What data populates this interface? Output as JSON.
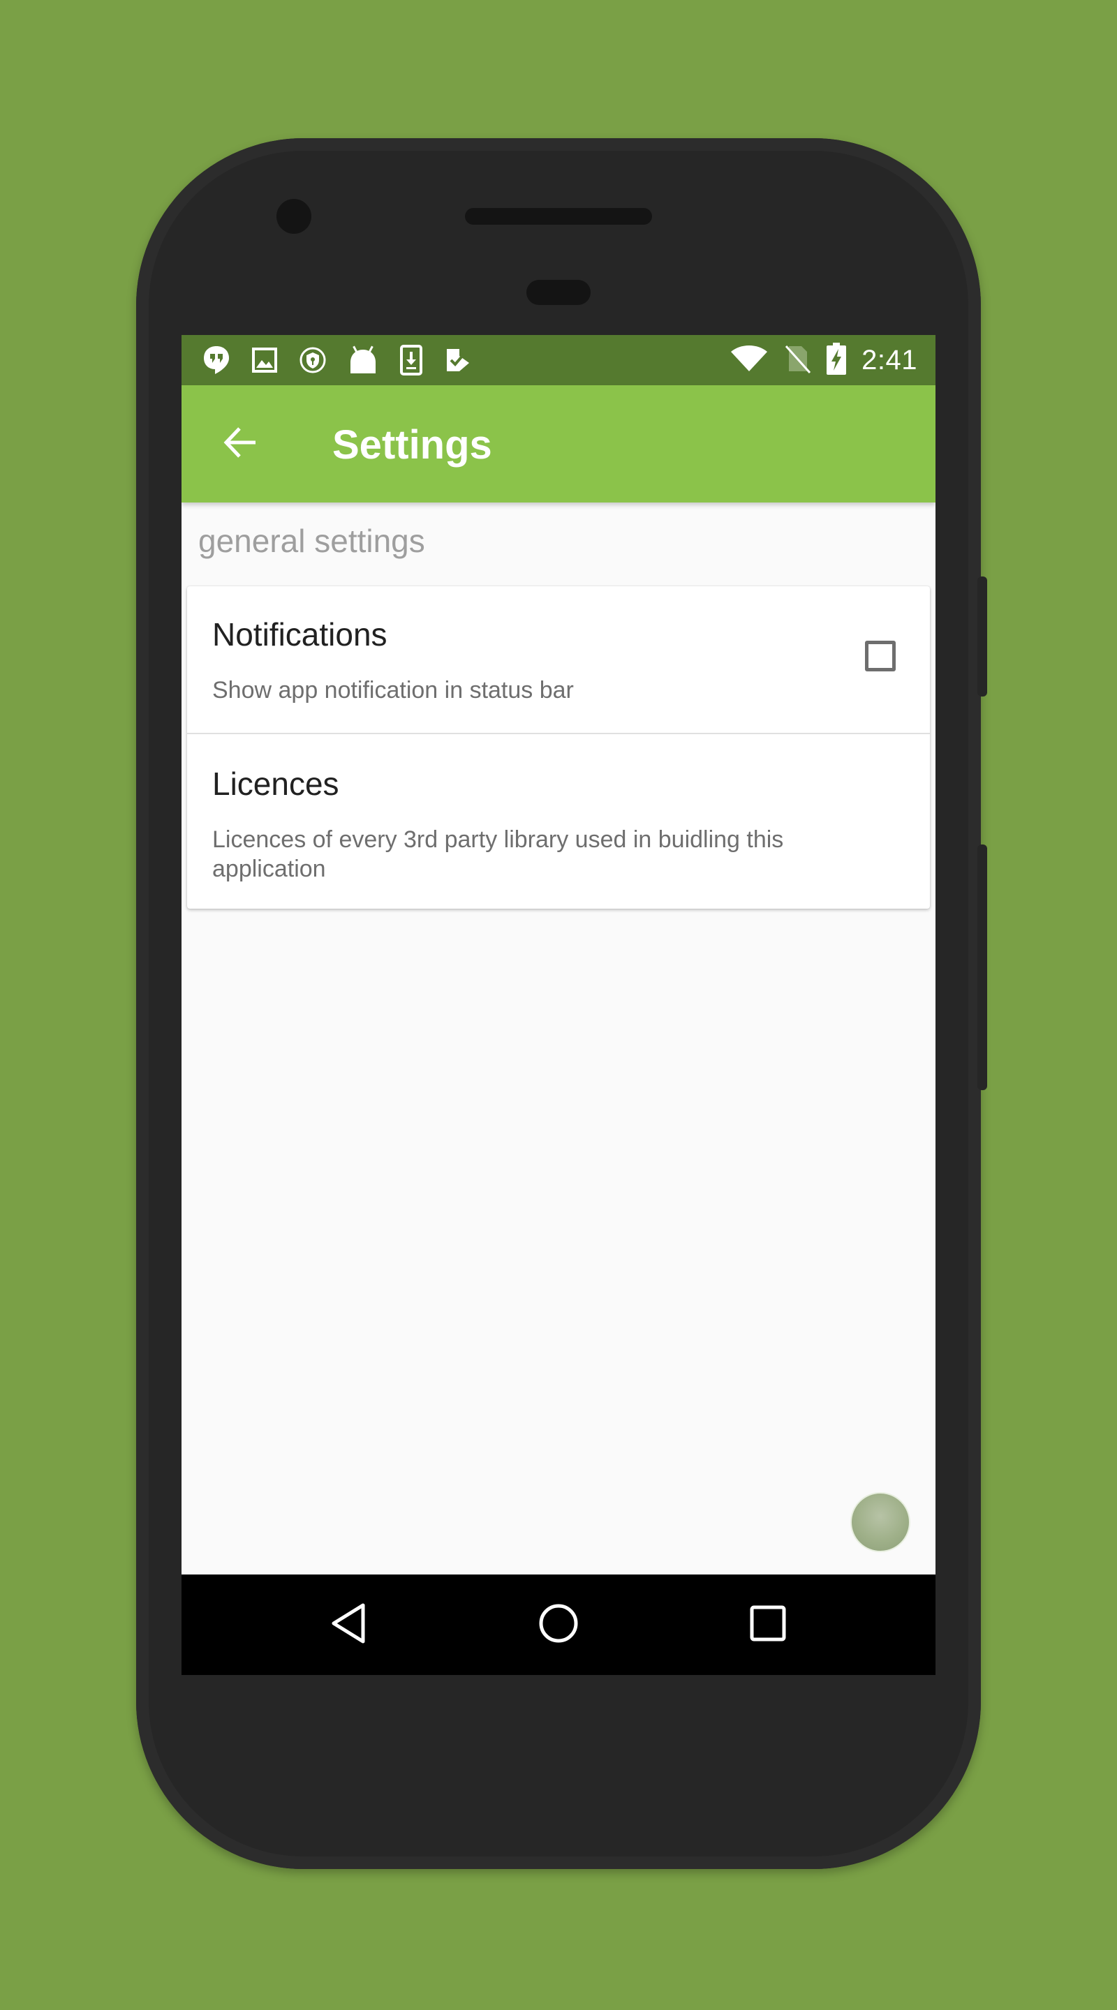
{
  "status_bar": {
    "time": "2:41",
    "left_icons": [
      "hangouts-icon",
      "image-icon",
      "shield-icon",
      "android-icon",
      "download-icon",
      "play-store-icon"
    ],
    "right_icons": [
      "wifi-icon",
      "no-sim-icon",
      "battery-charging-icon"
    ]
  },
  "app_bar": {
    "title": "Settings",
    "back_icon": "arrow-back-icon"
  },
  "category": {
    "label": "general settings"
  },
  "preferences": [
    {
      "title": "Notifications",
      "summary": "Show app notification in status bar",
      "checked": false
    },
    {
      "title": "Licences",
      "summary": "Licences of every 3rd party library used in buidling this application"
    }
  ],
  "colors": {
    "background": "#7aa046",
    "status_bar": "#557a2f",
    "app_bar": "#8bc34a",
    "screen": "#fafafa"
  },
  "nav_bar": {
    "icons": [
      "nav-back-icon",
      "nav-home-icon",
      "nav-recents-icon"
    ]
  }
}
